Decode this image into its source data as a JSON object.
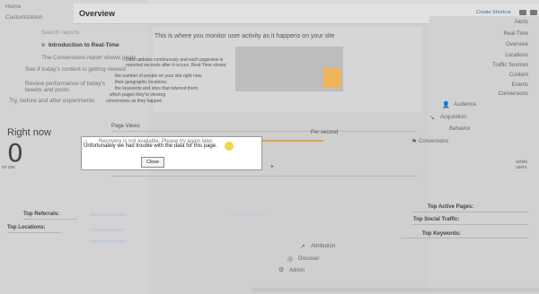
{
  "header": {
    "title": "Overview",
    "create_shortcut": "Create Shortcut"
  },
  "sidebar": {
    "top_label": "Home",
    "customization": "Customization",
    "search_placeholder": "Search reports",
    "intro": "Introduction to Real-Time",
    "item2": "The Conversions report shows goals ...",
    "item3": "See if today's content is getting viewed",
    "item4": "Review performance of today's tweets and posts",
    "item5": "Try, before and after experiments"
  },
  "intro_panel": {
    "heading": "This is where you monitor user activity as it happens on your site",
    "body1": "Data updates continuously and each pageview is",
    "body2": "reported seconds after it occurs. Real-Time shows:",
    "bullet1": "the number of people on your site right now,",
    "bullet2": "their geographic locations,",
    "bullet3": "the keywords and sites that referred them,",
    "bullet4": "which pages they're viewing",
    "bullet5": "conversions as they happen"
  },
  "right_nav": {
    "item0": "Alerts",
    "item1": "Real-Time",
    "item2": "Overview",
    "item3": "Locations",
    "item4": "Traffic Sources",
    "item5": "Content",
    "item6": "Events",
    "item7": "Conversions",
    "audience": "Audience",
    "acquisition": "Acquisition",
    "behavior": "Behavior",
    "conversions": "Conversions",
    "active_users": "active users"
  },
  "realtime": {
    "right_now": "Right now",
    "big_number": "0",
    "on_site": "on site",
    "page_views": "Page Views",
    "per_second": "Per second"
  },
  "modal": {
    "line1": "Recovery is not available. Please try again later.",
    "line2": "Unfortunately we had trouble with the data for this page.",
    "close": "Close"
  },
  "sections": {
    "top_referrals": "Top Referrals:",
    "top_locations": "Top Locations:",
    "top_active_pages": "Top Active Pages:",
    "top_social": "Top Social Traffic:",
    "top_keywords": "Top Keywords:"
  },
  "bottom_nav": {
    "attribution": "Attribution",
    "discover": "Discover",
    "admin": "Admin"
  }
}
